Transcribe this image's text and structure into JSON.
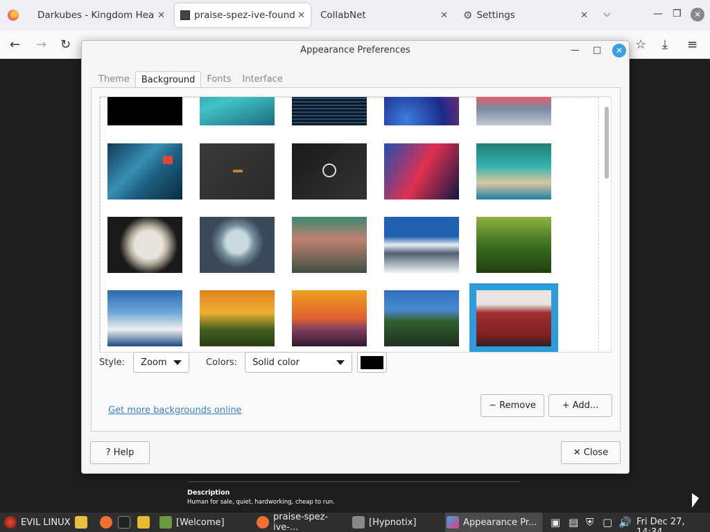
{
  "browser": {
    "tabs": [
      {
        "label": "Darkubes - Kingdom Heartl",
        "close": "✕"
      },
      {
        "label": "praise-spez-ive-found-th",
        "close": "✕",
        "active": true
      },
      {
        "label": "CollabNet",
        "close": "✕"
      },
      {
        "label": "Settings",
        "close": "✕"
      }
    ],
    "overflow_icon": "chevron-down-icon"
  },
  "page": {
    "description_title": "Description",
    "description_text": "Human for sale, quiet, hardworking, cheap to run."
  },
  "dialog": {
    "title": "Appearance Preferences",
    "tabs": [
      "Theme",
      "Background",
      "Fonts",
      "Interface"
    ],
    "active_tab": "Background",
    "style_label": "Style:",
    "style_value": "Zoom",
    "colors_label": "Colors:",
    "colors_value": "Solid color",
    "swatch_color": "#000000",
    "link": "Get more backgrounds online",
    "remove_button": "− Remove",
    "add_button": "+ Add...",
    "help_button": "? Help",
    "close_button": "✕ Close",
    "selected_thumbnail": "person in red sweater"
  },
  "taskbar": {
    "menu_label": "EVIL LINUX",
    "windows": [
      "[Welcome]",
      "praise-spez-ive-...",
      "[Hypnotix]",
      "Appearance Pr..."
    ],
    "clock": "Fri Dec 27, 14:34"
  },
  "colors": {
    "accent": "#2e9bdc",
    "link": "#3a7fc7",
    "taskbar": "#2f2f2f"
  }
}
